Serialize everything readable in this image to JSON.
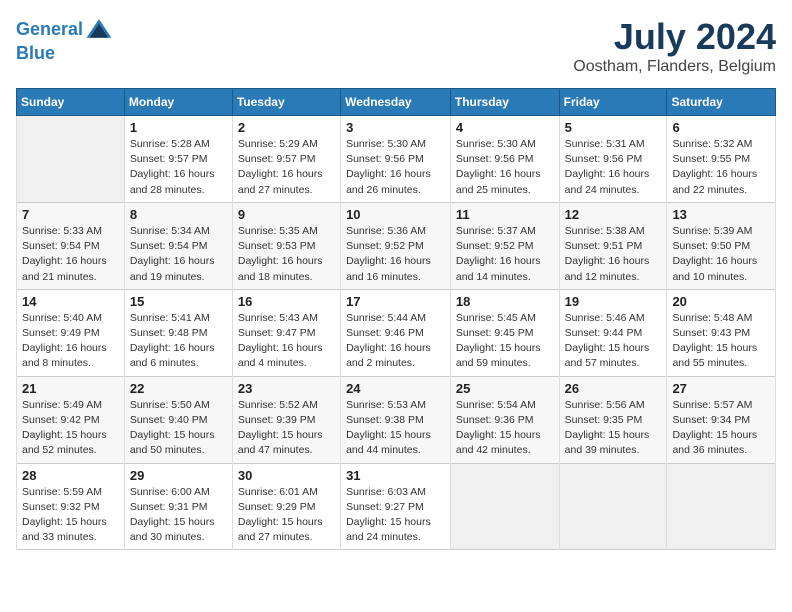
{
  "header": {
    "logo_line1": "General",
    "logo_line2": "Blue",
    "title": "July 2024",
    "subtitle": "Oostham, Flanders, Belgium"
  },
  "columns": [
    "Sunday",
    "Monday",
    "Tuesday",
    "Wednesday",
    "Thursday",
    "Friday",
    "Saturday"
  ],
  "weeks": [
    [
      {
        "num": "",
        "empty": true
      },
      {
        "num": "1",
        "rise": "5:28 AM",
        "set": "9:57 PM",
        "daylight": "16 hours and 28 minutes."
      },
      {
        "num": "2",
        "rise": "5:29 AM",
        "set": "9:57 PM",
        "daylight": "16 hours and 27 minutes."
      },
      {
        "num": "3",
        "rise": "5:30 AM",
        "set": "9:56 PM",
        "daylight": "16 hours and 26 minutes."
      },
      {
        "num": "4",
        "rise": "5:30 AM",
        "set": "9:56 PM",
        "daylight": "16 hours and 25 minutes."
      },
      {
        "num": "5",
        "rise": "5:31 AM",
        "set": "9:56 PM",
        "daylight": "16 hours and 24 minutes."
      },
      {
        "num": "6",
        "rise": "5:32 AM",
        "set": "9:55 PM",
        "daylight": "16 hours and 22 minutes."
      }
    ],
    [
      {
        "num": "7",
        "rise": "5:33 AM",
        "set": "9:54 PM",
        "daylight": "16 hours and 21 minutes."
      },
      {
        "num": "8",
        "rise": "5:34 AM",
        "set": "9:54 PM",
        "daylight": "16 hours and 19 minutes."
      },
      {
        "num": "9",
        "rise": "5:35 AM",
        "set": "9:53 PM",
        "daylight": "16 hours and 18 minutes."
      },
      {
        "num": "10",
        "rise": "5:36 AM",
        "set": "9:52 PM",
        "daylight": "16 hours and 16 minutes."
      },
      {
        "num": "11",
        "rise": "5:37 AM",
        "set": "9:52 PM",
        "daylight": "16 hours and 14 minutes."
      },
      {
        "num": "12",
        "rise": "5:38 AM",
        "set": "9:51 PM",
        "daylight": "16 hours and 12 minutes."
      },
      {
        "num": "13",
        "rise": "5:39 AM",
        "set": "9:50 PM",
        "daylight": "16 hours and 10 minutes."
      }
    ],
    [
      {
        "num": "14",
        "rise": "5:40 AM",
        "set": "9:49 PM",
        "daylight": "16 hours and 8 minutes."
      },
      {
        "num": "15",
        "rise": "5:41 AM",
        "set": "9:48 PM",
        "daylight": "16 hours and 6 minutes."
      },
      {
        "num": "16",
        "rise": "5:43 AM",
        "set": "9:47 PM",
        "daylight": "16 hours and 4 minutes."
      },
      {
        "num": "17",
        "rise": "5:44 AM",
        "set": "9:46 PM",
        "daylight": "16 hours and 2 minutes."
      },
      {
        "num": "18",
        "rise": "5:45 AM",
        "set": "9:45 PM",
        "daylight": "15 hours and 59 minutes."
      },
      {
        "num": "19",
        "rise": "5:46 AM",
        "set": "9:44 PM",
        "daylight": "15 hours and 57 minutes."
      },
      {
        "num": "20",
        "rise": "5:48 AM",
        "set": "9:43 PM",
        "daylight": "15 hours and 55 minutes."
      }
    ],
    [
      {
        "num": "21",
        "rise": "5:49 AM",
        "set": "9:42 PM",
        "daylight": "15 hours and 52 minutes."
      },
      {
        "num": "22",
        "rise": "5:50 AM",
        "set": "9:40 PM",
        "daylight": "15 hours and 50 minutes."
      },
      {
        "num": "23",
        "rise": "5:52 AM",
        "set": "9:39 PM",
        "daylight": "15 hours and 47 minutes."
      },
      {
        "num": "24",
        "rise": "5:53 AM",
        "set": "9:38 PM",
        "daylight": "15 hours and 44 minutes."
      },
      {
        "num": "25",
        "rise": "5:54 AM",
        "set": "9:36 PM",
        "daylight": "15 hours and 42 minutes."
      },
      {
        "num": "26",
        "rise": "5:56 AM",
        "set": "9:35 PM",
        "daylight": "15 hours and 39 minutes."
      },
      {
        "num": "27",
        "rise": "5:57 AM",
        "set": "9:34 PM",
        "daylight": "15 hours and 36 minutes."
      }
    ],
    [
      {
        "num": "28",
        "rise": "5:59 AM",
        "set": "9:32 PM",
        "daylight": "15 hours and 33 minutes."
      },
      {
        "num": "29",
        "rise": "6:00 AM",
        "set": "9:31 PM",
        "daylight": "15 hours and 30 minutes."
      },
      {
        "num": "30",
        "rise": "6:01 AM",
        "set": "9:29 PM",
        "daylight": "15 hours and 27 minutes."
      },
      {
        "num": "31",
        "rise": "6:03 AM",
        "set": "9:27 PM",
        "daylight": "15 hours and 24 minutes."
      },
      {
        "num": "",
        "empty": true
      },
      {
        "num": "",
        "empty": true
      },
      {
        "num": "",
        "empty": true
      }
    ]
  ]
}
